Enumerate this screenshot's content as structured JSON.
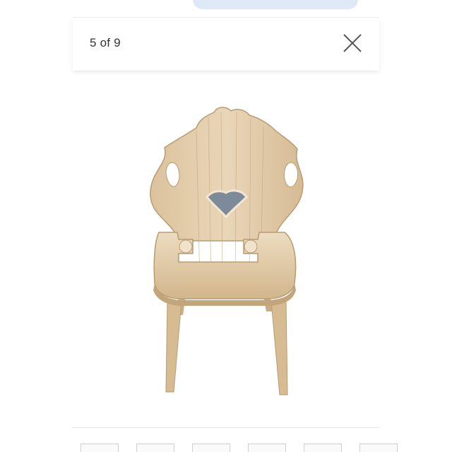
{
  "gallery": {
    "counter_text": "5 of 9",
    "current_index": 5,
    "total_images": 9
  },
  "icons": {
    "close": "close-icon"
  },
  "colors": {
    "background": "#ffffff",
    "top_pill": "#dfe8f5",
    "text": "#333333",
    "close_icon": "#555555",
    "wood_light": "#e8d3b4",
    "wood_mid": "#d9bf98",
    "wood_dark": "#b89b72",
    "inlay": "#7d8a9a"
  },
  "thumbnails": [
    {
      "name": "thumb-1"
    },
    {
      "name": "thumb-2"
    },
    {
      "name": "thumb-3"
    },
    {
      "name": "thumb-4"
    },
    {
      "name": "thumb-5"
    },
    {
      "name": "thumb-6"
    }
  ]
}
